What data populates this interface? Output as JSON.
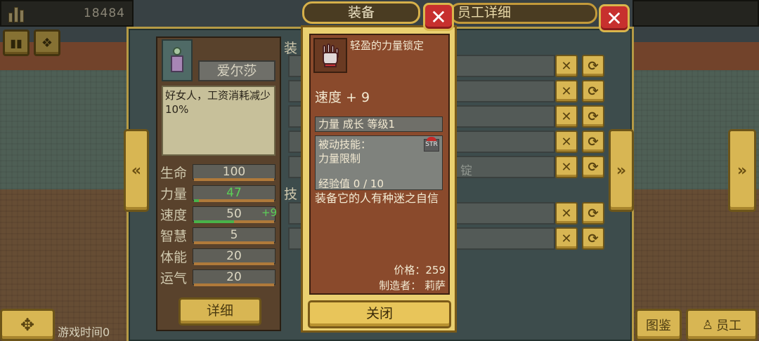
{
  "hud": {
    "money": "18484",
    "pause_label": "⏸",
    "speed_label": "⚙"
  },
  "main_dialog": {
    "title": "员工详细",
    "close_icon": "✕"
  },
  "character": {
    "name": "爱尔莎",
    "description": "好女人，工资消耗减少10%",
    "stats": [
      {
        "label": "生命",
        "value": "100",
        "bonus": "",
        "fill": 0.0
      },
      {
        "label": "力量",
        "value": "47",
        "bonus": "",
        "fill": 0.0
      },
      {
        "label": "速度",
        "value": "50",
        "bonus": "+9",
        "fill": 0.5
      },
      {
        "label": "智慧",
        "value": "5",
        "bonus": "",
        "fill": 0.0
      },
      {
        "label": "体能",
        "value": "20",
        "bonus": "",
        "fill": 0.0
      },
      {
        "label": "运气",
        "value": "20",
        "bonus": "",
        "fill": 0.0
      }
    ],
    "detail_button": "详细"
  },
  "slots": {
    "equip_label": "装",
    "skill_label": "技",
    "partial_text": "锭"
  },
  "equipment": {
    "tab_title": "装备",
    "item_name": "轻盈的力量锁定",
    "stat": "速度 + 9",
    "growth": "力量 成长 等级1",
    "passive_label": "被动技能：",
    "passive_value": "力量限制",
    "str_badge": "STR",
    "exp": "经验值 0 / 10",
    "flavor": "装备它的人有种迷之自信",
    "price": "价格：259",
    "maker": "制造者： 莉萨",
    "close_button": "关闭"
  },
  "bottom": {
    "game_time": "游戏时间0",
    "catalog_button": "图鉴",
    "staff_button": "员工"
  }
}
